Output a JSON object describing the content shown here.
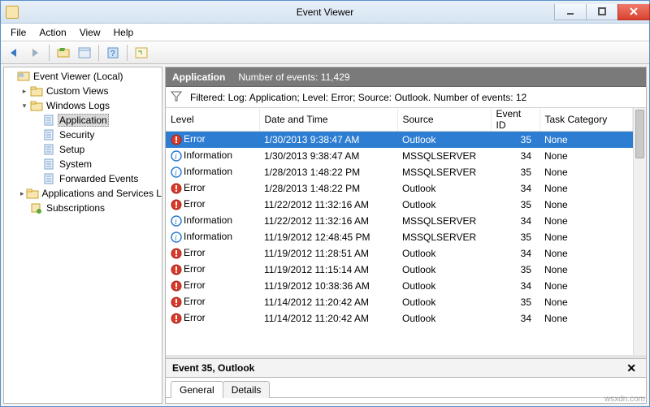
{
  "window": {
    "title": "Event Viewer"
  },
  "menubar": {
    "items": [
      "File",
      "Action",
      "View",
      "Help"
    ]
  },
  "toolbar": {
    "back_icon": "arrow-left-icon",
    "forward_icon": "arrow-right-icon",
    "up_icon": "folder-up-icon",
    "props_icon": "properties-icon",
    "help_icon": "help-icon",
    "refresh_icon": "refresh-icon"
  },
  "tree": {
    "root": {
      "label": "Event Viewer (Local)"
    },
    "nodes": [
      {
        "label": "Custom Views",
        "expandable": true,
        "expanded": false,
        "indent": 1,
        "icon": "folder"
      },
      {
        "label": "Windows Logs",
        "expandable": true,
        "expanded": true,
        "indent": 1,
        "icon": "folder"
      },
      {
        "label": "Application",
        "expandable": false,
        "indent": 2,
        "icon": "log",
        "selected": true
      },
      {
        "label": "Security",
        "expandable": false,
        "indent": 2,
        "icon": "log"
      },
      {
        "label": "Setup",
        "expandable": false,
        "indent": 2,
        "icon": "log"
      },
      {
        "label": "System",
        "expandable": false,
        "indent": 2,
        "icon": "log"
      },
      {
        "label": "Forwarded Events",
        "expandable": false,
        "indent": 2,
        "icon": "log"
      },
      {
        "label": "Applications and Services Logs",
        "expandable": true,
        "expanded": false,
        "indent": 1,
        "icon": "folder"
      },
      {
        "label": "Subscriptions",
        "expandable": false,
        "indent": 1,
        "icon": "subs"
      }
    ]
  },
  "main": {
    "heading": "Application",
    "subhead": "Number of events: 11,429",
    "filter_text": "Filtered: Log: Application; Level: Error; Source: Outlook. Number of events: 12",
    "columns": [
      "Level",
      "Date and Time",
      "Source",
      "Event ID",
      "Task Category"
    ],
    "rows": [
      {
        "level": "Error",
        "datetime": "1/30/2013 9:38:47 AM",
        "source": "Outlook",
        "event_id": 35,
        "category": "None",
        "selected": true
      },
      {
        "level": "Information",
        "datetime": "1/30/2013 9:38:47 AM",
        "source": "MSSQLSERVER",
        "event_id": 34,
        "category": "None"
      },
      {
        "level": "Information",
        "datetime": "1/28/2013 1:48:22 PM",
        "source": "MSSQLSERVER",
        "event_id": 35,
        "category": "None"
      },
      {
        "level": "Error",
        "datetime": "1/28/2013 1:48:22 PM",
        "source": "Outlook",
        "event_id": 34,
        "category": "None"
      },
      {
        "level": "Error",
        "datetime": "11/22/2012 11:32:16 AM",
        "source": "Outlook",
        "event_id": 35,
        "category": "None"
      },
      {
        "level": "Information",
        "datetime": "11/22/2012 11:32:16 AM",
        "source": "MSSQLSERVER",
        "event_id": 34,
        "category": "None"
      },
      {
        "level": "Information",
        "datetime": "11/19/2012 12:48:45 PM",
        "source": "MSSQLSERVER",
        "event_id": 35,
        "category": "None"
      },
      {
        "level": "Error",
        "datetime": "11/19/2012 11:28:51 AM",
        "source": "Outlook",
        "event_id": 34,
        "category": "None"
      },
      {
        "level": "Error",
        "datetime": "11/19/2012 11:15:14 AM",
        "source": "Outlook",
        "event_id": 35,
        "category": "None"
      },
      {
        "level": "Error",
        "datetime": "11/19/2012 10:38:36 AM",
        "source": "Outlook",
        "event_id": 34,
        "category": "None"
      },
      {
        "level": "Error",
        "datetime": "11/14/2012 11:20:42 AM",
        "source": "Outlook",
        "event_id": 35,
        "category": "None"
      },
      {
        "level": "Error",
        "datetime": "11/14/2012 11:20:42 AM",
        "source": "Outlook",
        "event_id": 34,
        "category": "None"
      }
    ],
    "details": {
      "title": "Event 35, Outlook",
      "tabs": [
        "General",
        "Details"
      ],
      "active_tab": 0
    }
  },
  "watermark": "wsxdn.com"
}
